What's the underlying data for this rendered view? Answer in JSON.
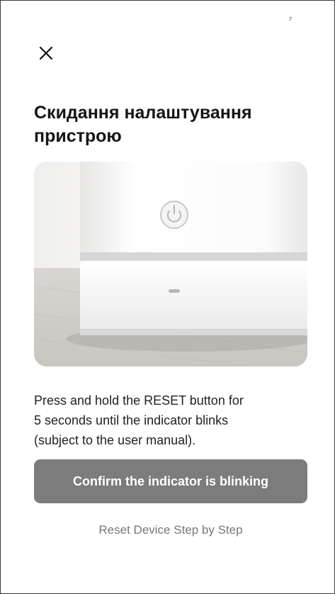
{
  "status_bar": {
    "mark": "⁷"
  },
  "header": {
    "close_icon": "close-icon"
  },
  "title": "Скидання налаштування пристрою",
  "illustration": {
    "icon": "power-icon"
  },
  "description": {
    "line1": "Press and hold the RESET button for",
    "line2": "5 seconds until the indicator blinks",
    "line3": "(subject to the user manual)."
  },
  "confirm_button": {
    "label": "Confirm the indicator is blinking",
    "color": "#7c7c7c"
  },
  "steps_link": {
    "label": "Reset Device Step by Step",
    "color": "#777777"
  }
}
